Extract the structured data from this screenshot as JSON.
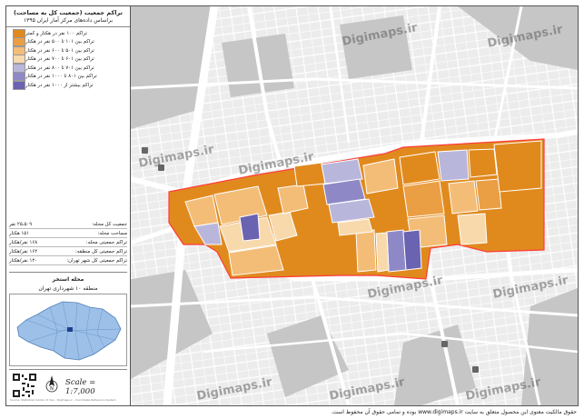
{
  "legend": {
    "title": "تراکم جمعیت (جمعیت کل به مساحت)",
    "subtitle": "براساس داده‌های مرکز آمار ایران ۱۳۹۵",
    "classes": [
      {
        "label": "تراکم ۱۰۰ نفر در هکتار و کمتر",
        "color": "#e08a1e"
      },
      {
        "label": "تراکم بین ۱۰۱ تا ۵۰۰ نفر در هکتار",
        "color": "#ea9f45"
      },
      {
        "label": "تراکم بین ۵۰۱ تا ۶۰۰ نفر در هکتار",
        "color": "#f3bd78"
      },
      {
        "label": "تراکم بین ۶۰۱ تا ۷۰۰ نفر در هکتار",
        "color": "#f8d9ac"
      },
      {
        "label": "تراکم بین ۷۰۱ تا ۸۰۰ نفر در هکتار",
        "color": "#b9b6db"
      },
      {
        "label": "تراکم بین ۸۰۱ تا ۱۰۰۰ نفر در هکتار",
        "color": "#8e89c6"
      },
      {
        "label": "تراکم بیشتر از ۱۰۰۰ نفر در هکتار",
        "color": "#6a63b1"
      }
    ]
  },
  "stats": [
    {
      "label": "جمعیت کل محله:",
      "value": "۲۵،۵۰۹ نفر"
    },
    {
      "label": "مساحت محله:",
      "value": "۱۵۱ هکتار"
    },
    {
      "label": "تراکم جمعیتی محله:",
      "value": "۱۶۸ نفر/هکتار"
    },
    {
      "label": "تراکم جمعیتی کل منطقه:",
      "value": "۱۶۲ نفر/هکتار"
    },
    {
      "label": "تراکم جمعیتی کل شهر تهران:",
      "value": "۱۲۰ نفر/هکتار"
    }
  ],
  "area": {
    "line1": "محله استخر",
    "line2": "منطقه ۱۰ شهرداری تهران"
  },
  "scale_text": "Scale = 1:7,000",
  "credit": "Source: Statistical Center of Iran - Digimaps.ir - Coordinate Reference System",
  "watermark": "Digimaps.ir",
  "footer": "حقوق مالکیت معنوی این محصول متعلق به سایت www.digimaps.ir بوده و تمامی حقوق آن محفوظ است.",
  "colors": {
    "base_light": "#efefef",
    "base_dark": "#c4c4c4",
    "road": "#ffffff",
    "boundary": "#ff3b3b",
    "inset_fill": "#9cc0e8",
    "inset_hl": "#1f3f8a"
  }
}
